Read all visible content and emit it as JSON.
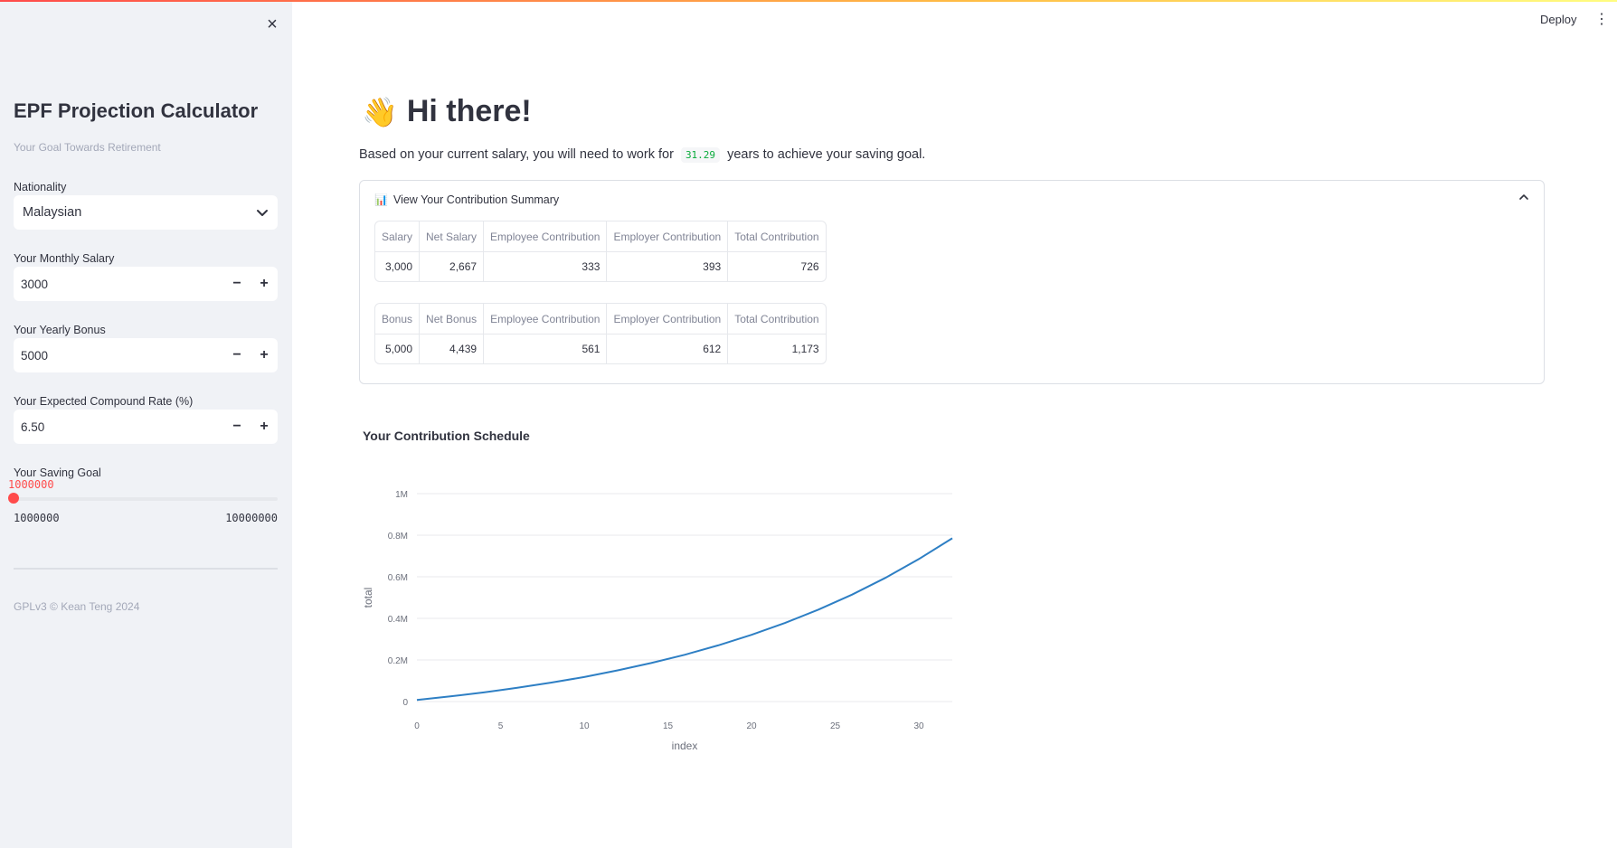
{
  "header": {
    "deploy_label": "Deploy",
    "menu_icon": "kebab-menu-icon"
  },
  "sidebar": {
    "close_icon": "×",
    "title": "EPF Projection Calculator",
    "subtitle": "Your Goal Towards Retirement",
    "nationality": {
      "label": "Nationality",
      "value": "Malaysian"
    },
    "monthly_salary": {
      "label": "Your Monthly Salary",
      "value": "3000"
    },
    "yearly_bonus": {
      "label": "Your Yearly Bonus",
      "value": "5000"
    },
    "compound_rate": {
      "label": "Your Expected Compound Rate (%)",
      "value": "6.50"
    },
    "saving_goal": {
      "label": "Your Saving Goal",
      "value": "1000000",
      "min": "1000000",
      "max": "10000000",
      "fraction": 0
    },
    "footer": "GPLv3 © Kean Teng 2024"
  },
  "main": {
    "greeting": "Hi there!",
    "greeting_icon": "👋",
    "summary_prefix": "Based on your current salary, you will need to work for",
    "years": "31.29",
    "summary_suffix": "years to achieve your saving goal.",
    "expander": {
      "label": "View Your Contribution Summary",
      "icon": "📊",
      "salary_table": {
        "headers": [
          "Salary",
          "Net Salary",
          "Employee Contribution",
          "Employer Contribution",
          "Total Contribution"
        ],
        "row": [
          "3,000",
          "2,667",
          "333",
          "393",
          "726"
        ]
      },
      "bonus_table": {
        "headers": [
          "Bonus",
          "Net Bonus",
          "Employee Contribution",
          "Employer Contribution",
          "Total Contribution"
        ],
        "row": [
          "5,000",
          "4,439",
          "561",
          "612",
          "1,173"
        ]
      }
    },
    "chart_title": "Your Contribution Schedule"
  },
  "chart_data": {
    "type": "line",
    "xlabel": "index",
    "ylabel": "total",
    "xlim": [
      0,
      32
    ],
    "ylim": [
      0,
      1000000
    ],
    "x_ticks": [
      0,
      5,
      10,
      15,
      20,
      25,
      30
    ],
    "y_ticks": [
      0,
      200000,
      400000,
      600000,
      800000,
      1000000
    ],
    "y_tick_labels": [
      "0",
      "0.2M",
      "0.4M",
      "0.6M",
      "0.8M",
      "1M"
    ],
    "grid": true,
    "line_color": "#2e7fc4",
    "series": [
      {
        "x": [
          0,
          2,
          4,
          6,
          8,
          10,
          12,
          14,
          16,
          18,
          20,
          22,
          24,
          26,
          28,
          30,
          32
        ],
        "y": [
          8000,
          25000,
          44000,
          66000,
          91000,
          118000,
          150000,
          185000,
          225000,
          270000,
          321000,
          378000,
          442000,
          514000,
          595000,
          685000,
          785000
        ]
      }
    ]
  }
}
